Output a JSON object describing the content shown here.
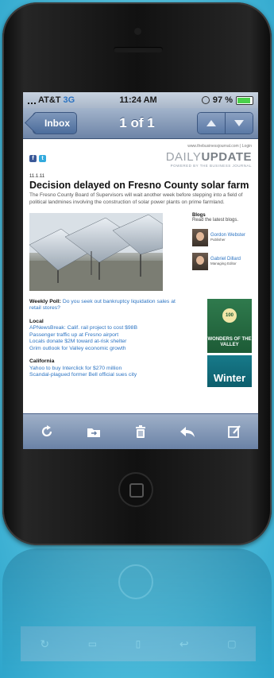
{
  "status_bar": {
    "carrier": "AT&T",
    "network": "3G",
    "time": "11:24 AM",
    "battery_text": "97 %",
    "battery_level": 0.97
  },
  "nav_bar": {
    "back_label": "Inbox",
    "title": "1 of 1"
  },
  "email": {
    "url_text": "www.thebusinessjournal.com | Login",
    "brand_light": "DAILY",
    "brand_bold": "UPDATE",
    "brand_sub": "POWERED BY THE BUSINESS JOURNAL",
    "date": "11.1.11",
    "headline": "Decision delayed on Fresno County solar farm",
    "summary": "The Fresno County Board of Supervisors will wait another week before stepping into a field of political landmines involving the construction of solar power plants on prime farmland.",
    "blogs": {
      "title": "Blogs",
      "subtitle": "Read the latest blogs.",
      "authors": [
        {
          "name": "Gordon Webster",
          "role": "Publisher"
        },
        {
          "name": "Gabriel Dillard",
          "role": "Managing Editor"
        }
      ]
    },
    "poll_label": "Weekly Poll:",
    "poll_question": "Do you seek out bankruptcy liquidation sales at retail stores?",
    "sections": [
      {
        "title": "Local",
        "links": [
          "APNewsBreak: Calif. rail project to cost $98B",
          "Passenger traffic up at Fresno airport",
          "Locals donate $2M toward at-risk shelter",
          "Grim outlook for Valley economic growth"
        ]
      },
      {
        "title": "California",
        "links": [
          "Yahoo to buy Interclick for $270 million",
          "Scandal-plagued former Bell official sues city"
        ]
      }
    ],
    "ads": {
      "green_badge": "100",
      "green_text": "WONDERS OF THE VALLEY",
      "winter_text": "Winter"
    }
  },
  "toolbar": {
    "icons": [
      "refresh-icon",
      "move-folder-icon",
      "trash-icon",
      "reply-icon",
      "compose-icon"
    ]
  }
}
